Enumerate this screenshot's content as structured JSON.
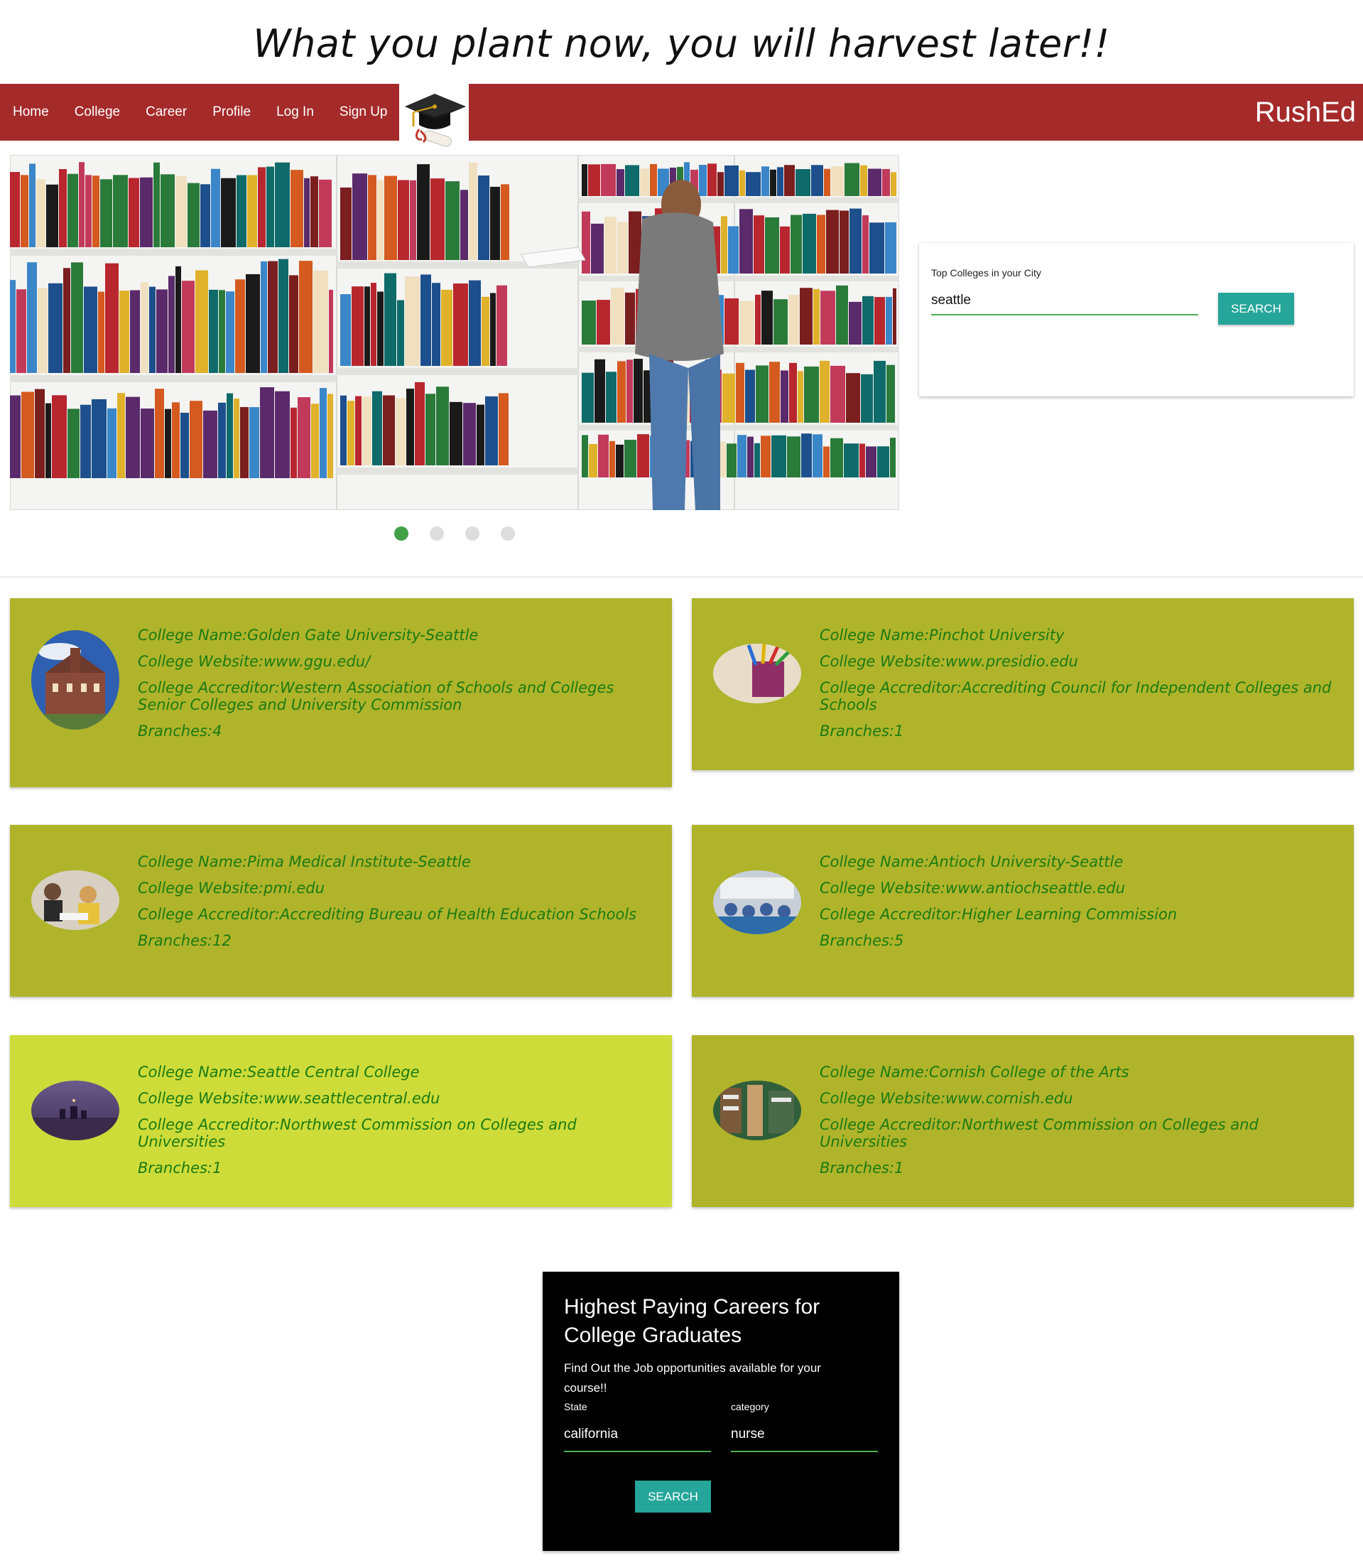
{
  "tagline": "What you plant now, you will harvest later!!",
  "nav": {
    "items": [
      "Home",
      "College",
      "Career",
      "Profile",
      "Log In",
      "Sign Up"
    ],
    "brand": "RushEd"
  },
  "carousel": {
    "slides": 4,
    "active_index": 0
  },
  "city_search": {
    "label": "Top Colleges in your City",
    "value": "seattle",
    "button": "SEARCH"
  },
  "colleges": [
    {
      "name": "College Name:Golden Gate University-Seattle",
      "website": "College Website:www.ggu.edu/",
      "accreditor": "College Accreditor:Western Association of Schools and Colleges Senior Colleges and University Commission",
      "branches": "Branches:4"
    },
    {
      "name": "College Name:Pinchot University",
      "website": "College Website:www.presidio.edu",
      "accreditor": "College Accreditor:Accrediting Council for Independent Colleges and Schools",
      "branches": "Branches:1"
    },
    {
      "name": "College Name:Pima Medical Institute-Seattle",
      "website": "College Website:pmi.edu",
      "accreditor": "College Accreditor:Accrediting Bureau of Health Education Schools",
      "branches": "Branches:12"
    },
    {
      "name": "College Name:Antioch University-Seattle",
      "website": "College Website:www.antiochseattle.edu",
      "accreditor": "College Accreditor:Higher Learning Commission",
      "branches": "Branches:5"
    },
    {
      "name": "College Name:Seattle Central College",
      "website": "College Website:www.seattlecentral.edu",
      "accreditor": "College Accreditor:Northwest Commission on Colleges and Universities",
      "branches": "Branches:1"
    },
    {
      "name": "College Name:Cornish College of the Arts",
      "website": "College Website:www.cornish.edu",
      "accreditor": "College Accreditor:Northwest Commission on Colleges and Universities",
      "branches": "Branches:1"
    }
  ],
  "career": {
    "title": "Highest Paying Careers for College Graduates",
    "description": "Find Out the Job opportunities available for your course!!",
    "state_label": "State",
    "state_value": "california",
    "category_label": "category",
    "category_value": "nurse",
    "button": "SEARCH"
  },
  "colors": {
    "nav": "#a52a2a",
    "card": "#afb42b",
    "card_highlight": "#cddc39",
    "card_text": "#1b7a12",
    "button": "#26a69a",
    "input_underline": "#4caf50",
    "dot_active": "#43a047"
  }
}
